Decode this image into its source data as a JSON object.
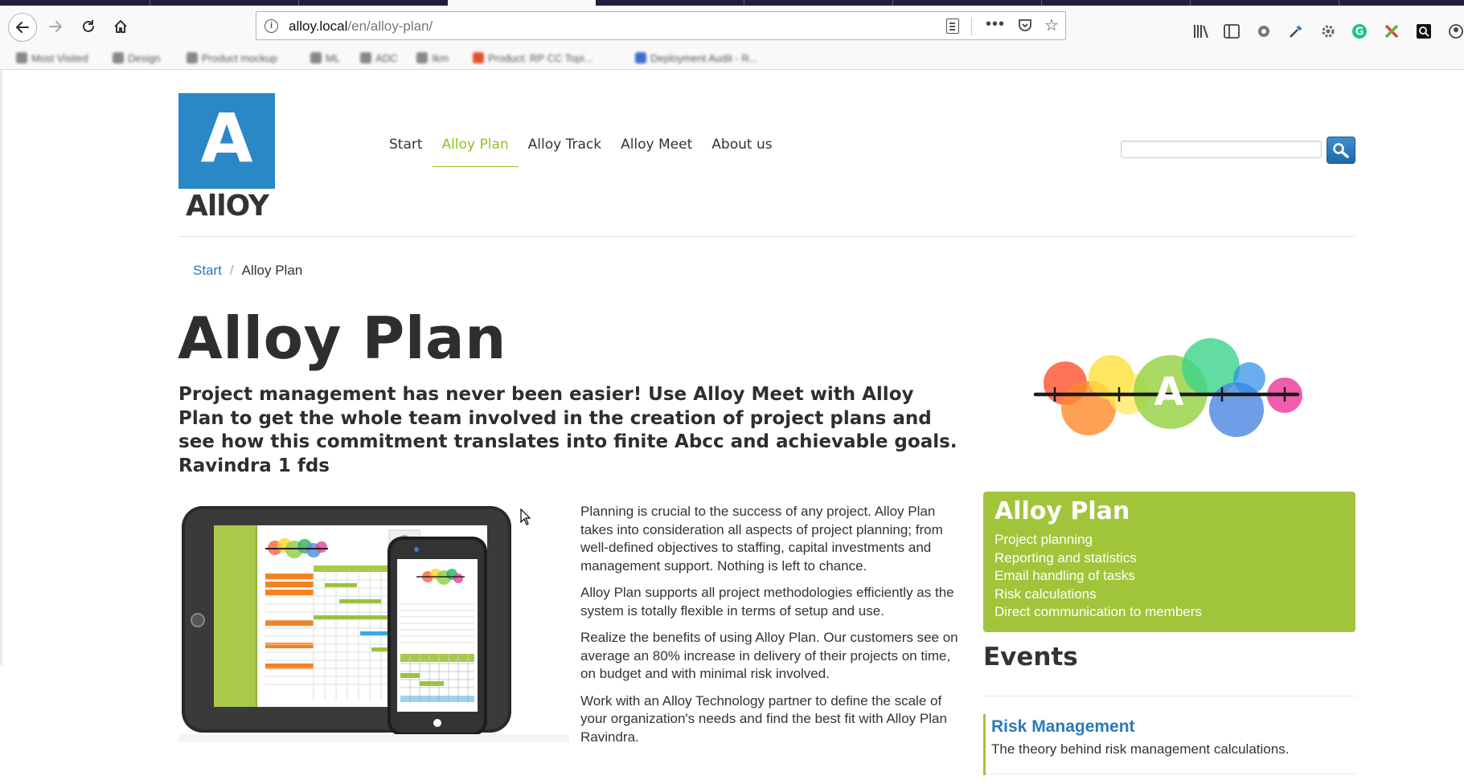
{
  "browser": {
    "url_host": "alloy.local",
    "url_path": "/en/alloy-plan/",
    "bookmarks": [
      "Most Visited",
      "Design",
      "Product mockup",
      "ML",
      "ADC",
      "Ikm",
      "Product: RP CC Topi...",
      "Deployment Audit - R..."
    ]
  },
  "site": {
    "logo_letter": "A",
    "logo_word": "AllOY",
    "nav": [
      "Start",
      "Alloy Plan",
      "Alloy Track",
      "Alloy Meet",
      "About us"
    ],
    "active_nav": "Alloy Plan",
    "search": {
      "placeholder": ""
    }
  },
  "breadcrumb": {
    "link": "Start",
    "separator": "/",
    "current": "Alloy Plan"
  },
  "page": {
    "title": "Alloy Plan",
    "intro": "Project management has never been easier! Use Alloy Meet with Alloy Plan to get the whole team involved in the creation of project plans and see how this commitment translates into finite Abcc and achievable goals. Ravindra 1 fds",
    "paragraphs": [
      "Planning is crucial to the success of any project. Alloy Plan takes into consideration all aspects of project planning; from well-defined objectives to staffing, capital investments and management support. Nothing is left to chance.",
      "Alloy Plan supports all project methodologies efficiently as the system is totally flexible in terms of setup and use.",
      "Realize the benefits of using Alloy Plan. Our customers see on average an 80% increase in delivery of their projects on time, on budget and with minimal risk involved.",
      "Work with an Alloy Technology partner to define the scale of your organization's needs and find the best fit with Alloy Plan Ravindra."
    ]
  },
  "teaser": {
    "title": "Alloy Plan",
    "items": [
      "Project planning",
      "Reporting and statistics",
      "Email handling of tasks",
      "Risk calculations",
      "Direct communication to members"
    ]
  },
  "events": {
    "title": "Events",
    "items": [
      {
        "title": "Risk Management",
        "description": "The theory behind risk management calculations."
      }
    ]
  },
  "colors": {
    "accent_green": "#a1c53a",
    "nav_active": "#8ec31e",
    "link_blue": "#2a7ab8",
    "logo_blue": "#2a88c6"
  }
}
